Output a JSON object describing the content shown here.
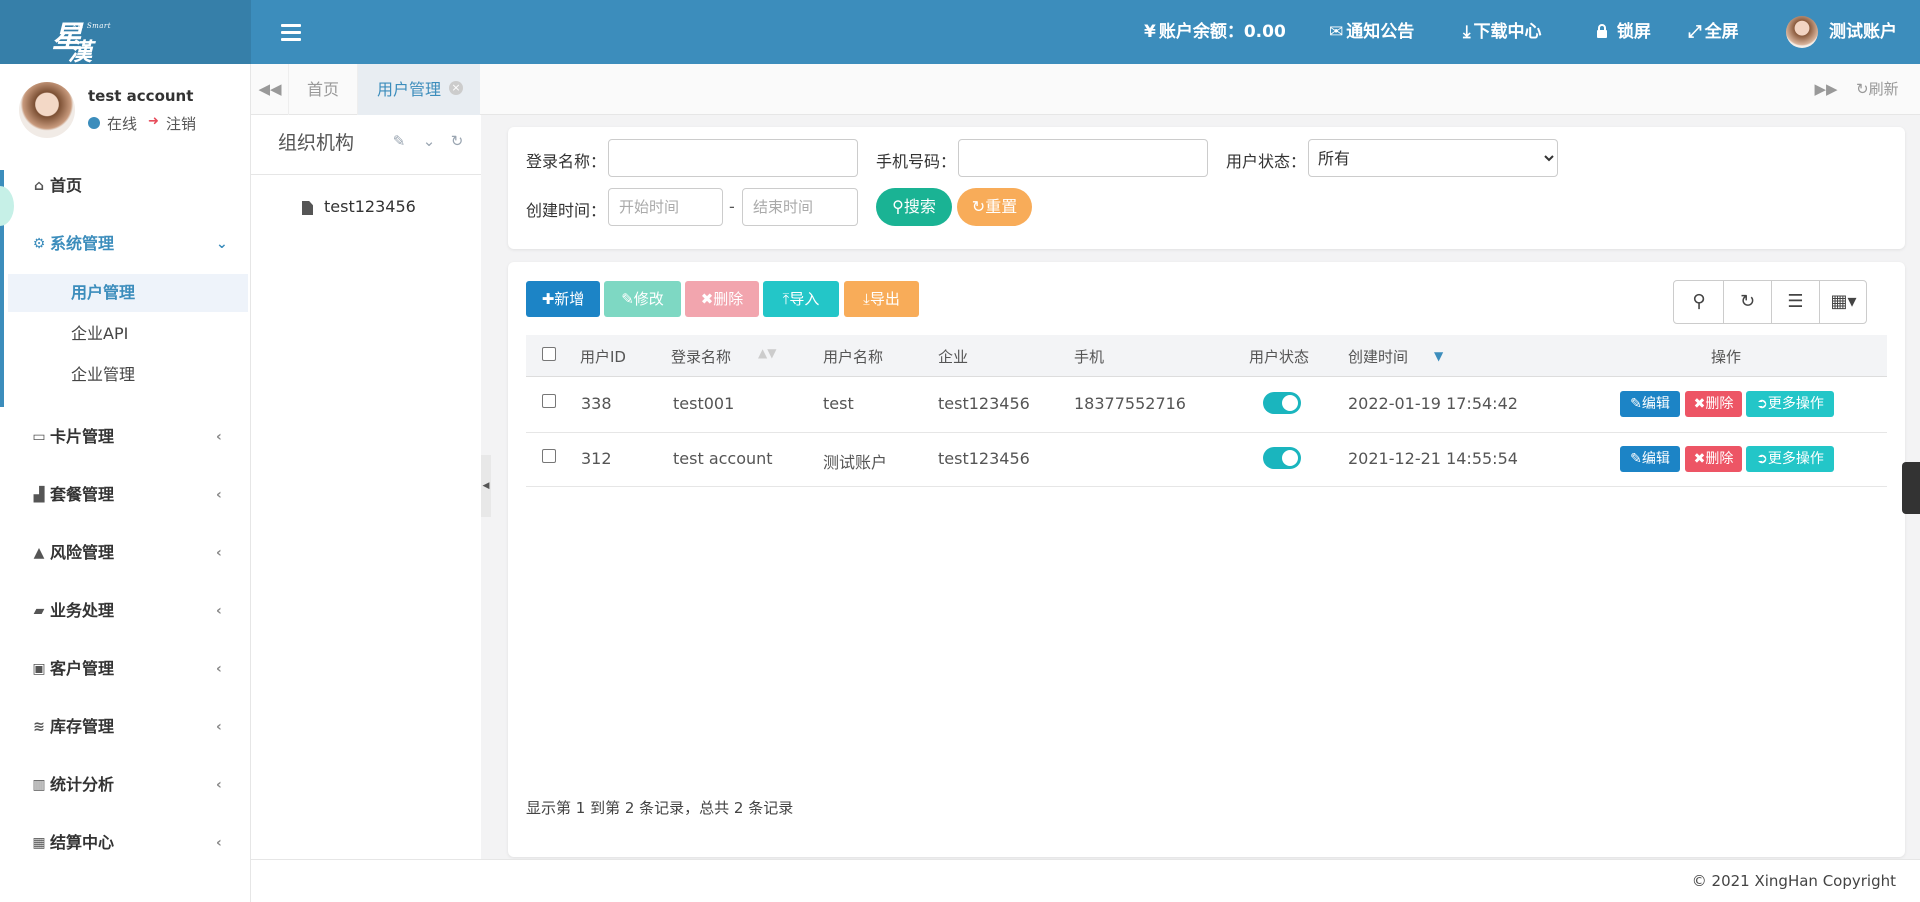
{
  "header": {
    "logo": {
      "big": "星",
      "small": "XH Smart",
      "big2": "漢"
    },
    "balance": "账户余额：0.00",
    "notice": "通知公告",
    "download": "下载中心",
    "lock": "锁屏",
    "fullscreen": "全屏",
    "account": "测试账户"
  },
  "sidebar": {
    "user_name": "test account",
    "status": "在线",
    "logout": "注销",
    "menu": [
      {
        "label": "首页",
        "icon": "home-icon"
      },
      {
        "label": "系统管理",
        "icon": "gear-icon",
        "active": true
      },
      {
        "label": "卡片管理",
        "icon": "credit-card-icon"
      },
      {
        "label": "套餐管理",
        "icon": "area-chart-icon"
      },
      {
        "label": "风险管理",
        "icon": "warning-icon"
      },
      {
        "label": "业务处理",
        "icon": "book-icon"
      },
      {
        "label": "客户管理",
        "icon": "contact-icon"
      },
      {
        "label": "库存管理",
        "icon": "database-icon"
      },
      {
        "label": "统计分析",
        "icon": "bar-chart-icon"
      },
      {
        "label": "结算中心",
        "icon": "calculator-icon"
      }
    ],
    "sub_menu": [
      {
        "label": "用户管理",
        "active": true
      },
      {
        "label": "企业API"
      },
      {
        "label": "企业管理"
      }
    ]
  },
  "tabs": {
    "home": "首页",
    "users": "用户管理",
    "refresh": "刷新"
  },
  "org": {
    "title": "组织机构",
    "node": "test123456"
  },
  "search": {
    "login_label": "登录名称：",
    "login_value": "",
    "phone_label": "手机号码：",
    "phone_value": "",
    "status_label": "用户状态：",
    "status_selected": "所有",
    "created_label": "创建时间：",
    "start_placeholder": "开始时间",
    "end_placeholder": "结束时间",
    "range_sep": "-",
    "search_btn": "搜索",
    "reset_btn": "重置"
  },
  "toolbar": {
    "add": "新增",
    "edit": "修改",
    "delete": "删除",
    "import": "导入",
    "export": "导出"
  },
  "table": {
    "columns": [
      "用户ID",
      "登录名称",
      "用户名称",
      "企业",
      "手机",
      "用户状态",
      "创建时间",
      "操作"
    ],
    "rows": [
      {
        "id": "338",
        "login": "test001",
        "name": "test",
        "company": "test123456",
        "phone": "18377552716",
        "enabled": true,
        "created": "2022-01-19 17:54:42"
      },
      {
        "id": "312",
        "login": "test account",
        "name": "测试账户",
        "company": "test123456",
        "phone": "",
        "enabled": true,
        "created": "2021-12-21 14:55:54"
      }
    ],
    "op_edit": "编辑",
    "op_delete": "删除",
    "op_more": "更多操作",
    "pager_info": "显示第 1 到第 2 条记录，总共 2 条记录"
  },
  "footer": {
    "copyright": "© 2021 XingHan Copyright"
  },
  "colors": {
    "primary": "#3c8dbc",
    "success": "#1ab394",
    "warning": "#f8ac59",
    "danger": "#ed5565",
    "info": "#23c6c8",
    "toggle": "#1ab5be"
  }
}
